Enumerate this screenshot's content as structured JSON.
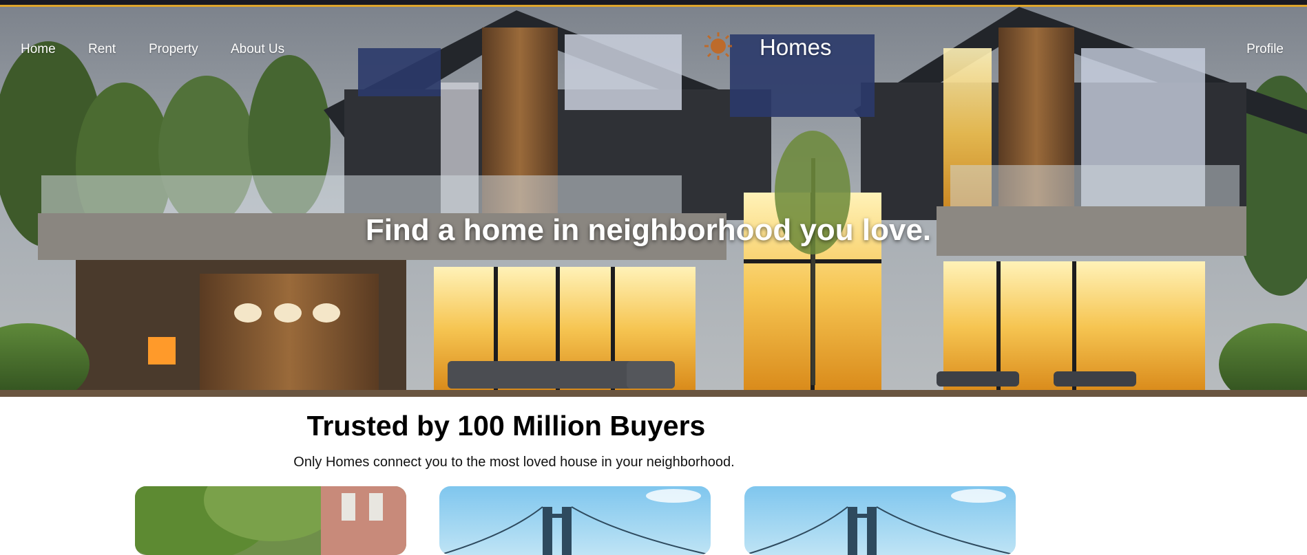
{
  "nav": {
    "links": [
      {
        "label": "Home"
      },
      {
        "label": "Rent"
      },
      {
        "label": "Property"
      },
      {
        "label": "About Us"
      }
    ],
    "brand": "Homes",
    "profile": "Profile"
  },
  "hero": {
    "headline": "Find a home in neighborhood you love."
  },
  "trusted": {
    "title": "Trusted by 100 Million Buyers",
    "subtitle": "Only Homes connect you to the most loved house in your neighborhood."
  },
  "colors": {
    "accent": "#e0a62a",
    "text_light": "#ffffff",
    "text_dark": "#000000"
  },
  "icons": [
    "sun-logo-icon"
  ]
}
